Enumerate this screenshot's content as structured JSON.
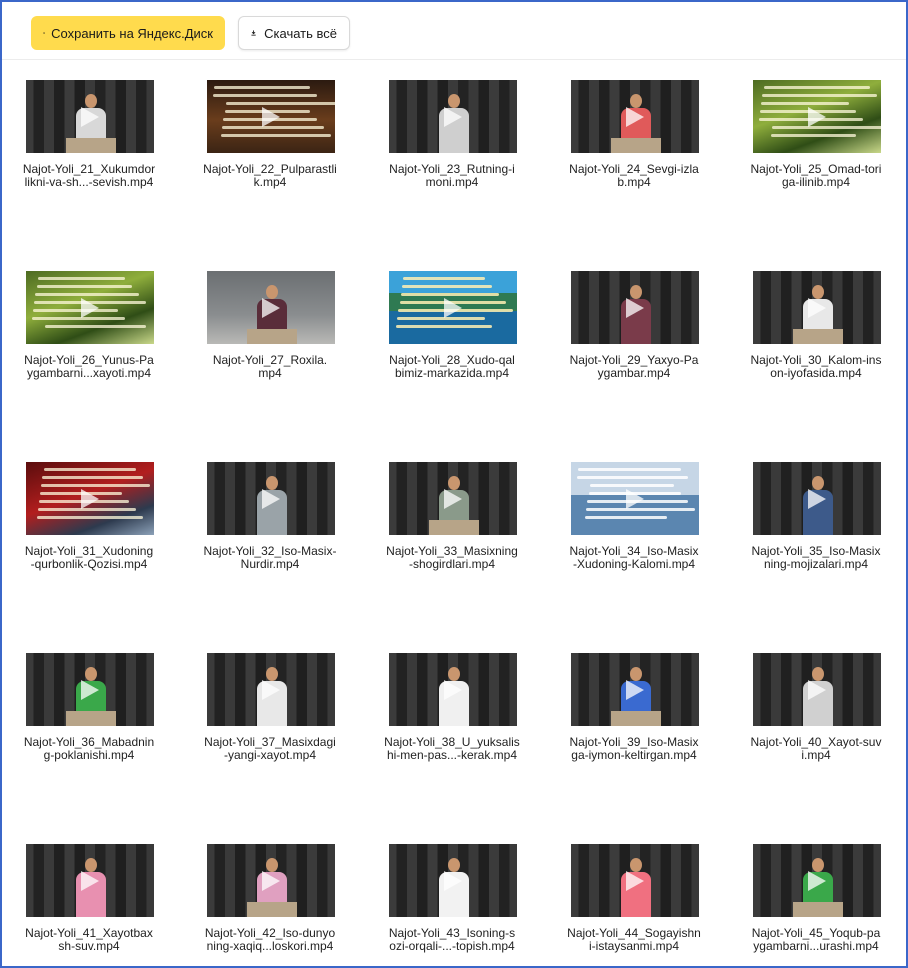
{
  "toolbar": {
    "save_label": "Сохранить на Яндекс.Диск",
    "download_label": "Скачать всё",
    "save_color": "#ffdb4d",
    "save_icon": "yandex-disk-icon",
    "download_icon": "download-icon"
  },
  "files": [
    {
      "line1": "Najot-Yoli_21_Xukumdor",
      "line2": "likni-va-sh...-sevish.mp4",
      "thumb": "dark",
      "shirt": "#d8d8d8"
    },
    {
      "line1": "Najot-Yoli_22_Pulparastli",
      "line2": "k.mp4",
      "thumb": "brown",
      "shirt": ""
    },
    {
      "line1": "Najot-Yoli_23_Rutning-i",
      "line2": "moni.mp4",
      "thumb": "dark",
      "shirt": "#cfcfcf"
    },
    {
      "line1": "Najot-Yoli_24_Sevgi-izla",
      "line2": "b.mp4",
      "thumb": "dark",
      "shirt": "#e05a5a"
    },
    {
      "line1": "Najot-Yoli_25_Omad-tori",
      "line2": "ga-ilinib.mp4",
      "thumb": "nature",
      "shirt": ""
    },
    {
      "line1": "Najot-Yoli_26_Yunus-Pa",
      "line2": "ygambarni...xayoti.mp4",
      "thumb": "nature",
      "shirt": ""
    },
    {
      "line1": "Najot-Yoli_27_Roxila.",
      "line2": "mp4",
      "thumb": "gray",
      "shirt": "#5a2d3a"
    },
    {
      "line1": "Najot-Yoli_28_Xudo-qal",
      "line2": "bimiz-markazida.mp4",
      "thumb": "lake",
      "shirt": ""
    },
    {
      "line1": "Najot-Yoli_29_Yaxyo-Pa",
      "line2": "ygambar.mp4",
      "thumb": "dark",
      "shirt": "#7a3b4a"
    },
    {
      "line1": "Najot-Yoli_30_Kalom-ins",
      "line2": "on-iyofasida.mp4",
      "thumb": "dark",
      "shirt": "#e8e8e8"
    },
    {
      "line1": "Najot-Yoli_31_Xudoning",
      "line2": "-qurbonlik-Qozisi.mp4",
      "thumb": "fall",
      "shirt": ""
    },
    {
      "line1": "Najot-Yoli_32_Iso-Masix-",
      "line2": "Nurdir.mp4",
      "thumb": "dark",
      "shirt": "#9aa3a8"
    },
    {
      "line1": "Najot-Yoli_33_Masixning",
      "line2": "-shogirdlari.mp4",
      "thumb": "dark",
      "shirt": "#8a9a8a"
    },
    {
      "line1": "Najot-Yoli_34_Iso-Masix",
      "line2": "-Xudoning-Kalomi.mp4",
      "thumb": "sea",
      "shirt": ""
    },
    {
      "line1": "Najot-Yoli_35_Iso-Masix",
      "line2": "ning-mojizalari.mp4",
      "thumb": "dark",
      "shirt": "#3d5a8a"
    },
    {
      "line1": "Najot-Yoli_36_Mabadnin",
      "line2": "g-poklanishi.mp4",
      "thumb": "dark",
      "shirt": "#3aa84a"
    },
    {
      "line1": "Najot-Yoli_37_Masixdagi",
      "line2": "-yangi-xayot.mp4",
      "thumb": "dark",
      "shirt": "#e8e8e8"
    },
    {
      "line1": "Najot-Yoli_38_U_yuksalis",
      "line2": "hi-men-pas...-kerak.mp4",
      "thumb": "dark",
      "shirt": "#f0f0f0"
    },
    {
      "line1": "Najot-Yoli_39_Iso-Masix",
      "line2": "ga-iymon-keltirgan.mp4",
      "thumb": "dark",
      "shirt": "#3a6ad0"
    },
    {
      "line1": "Najot-Yoli_40_Xayot-suv",
      "line2": "i.mp4",
      "thumb": "dark",
      "shirt": "#d0d0d0"
    },
    {
      "line1": "Najot-Yoli_41_Xayotbax",
      "line2": "sh-suv.mp4",
      "thumb": "dark",
      "shirt": "#e890b0"
    },
    {
      "line1": "Najot-Yoli_42_Iso-dunyo",
      "line2": "ning-xaqiq...loskori.mp4",
      "thumb": "dark",
      "shirt": "#e0a0c0"
    },
    {
      "line1": "Najot-Yoli_43_Isoning-s",
      "line2": "ozi-orqali-...-topish.mp4",
      "thumb": "dark",
      "shirt": "#f2f2f2"
    },
    {
      "line1": "Najot-Yoli_44_Sogayishn",
      "line2": "i-istaysanmi.mp4",
      "thumb": "dark",
      "shirt": "#f07080"
    },
    {
      "line1": "Najot-Yoli_45_Yoqub-pa",
      "line2": "ygambarni...urashi.mp4",
      "thumb": "dark",
      "shirt": "#3aa84a"
    }
  ]
}
